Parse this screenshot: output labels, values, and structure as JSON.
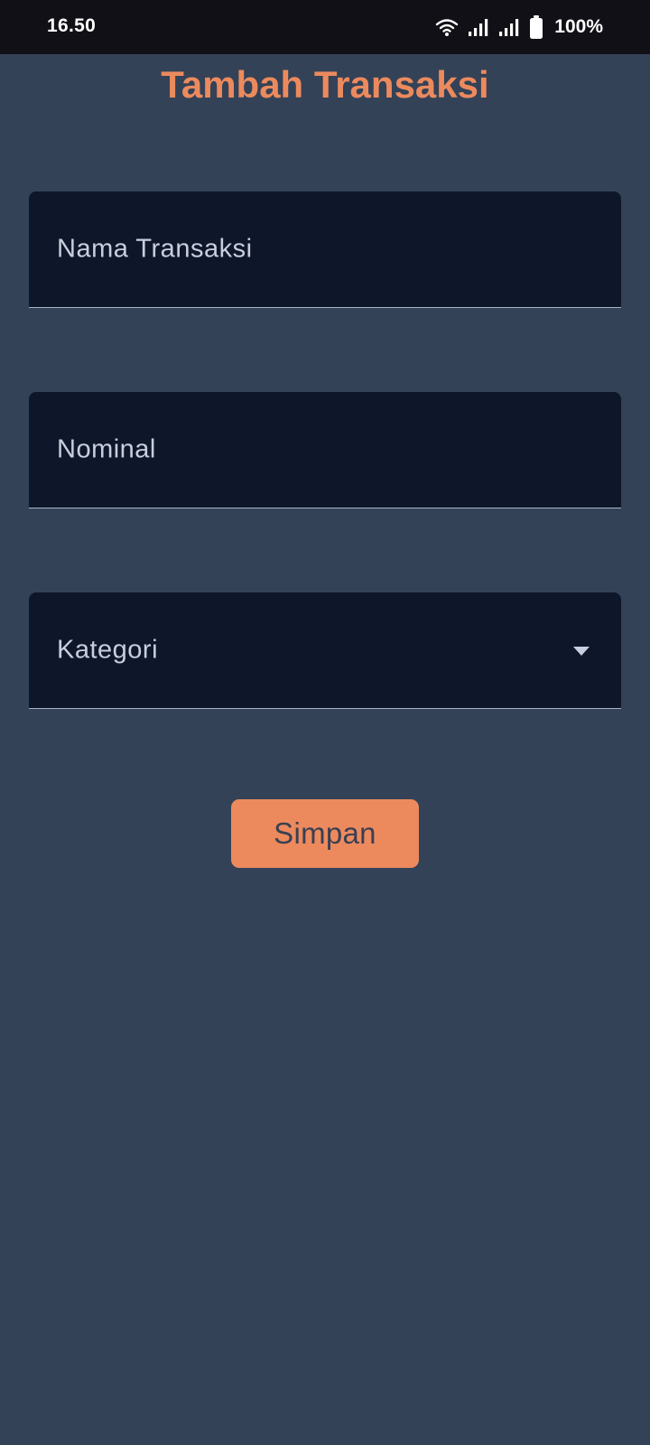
{
  "status_bar": {
    "time": "16.50",
    "battery_text": "100%",
    "icons": [
      "wifi-icon",
      "signal-icon",
      "signal-icon",
      "battery-icon"
    ]
  },
  "title": "Tambah Transaksi",
  "form": {
    "name_field": {
      "placeholder": "Nama Transaksi",
      "value": ""
    },
    "amount_field": {
      "placeholder": "Nominal",
      "value": ""
    },
    "category_field": {
      "placeholder": "Kategori",
      "selected": "",
      "icon": "chevron-down-icon"
    }
  },
  "save_button": {
    "label": "Simpan"
  },
  "colors": {
    "background": "#334257",
    "accent": "#ec8a5e",
    "field_background": "#0e1729",
    "status_bar": "#121017"
  }
}
